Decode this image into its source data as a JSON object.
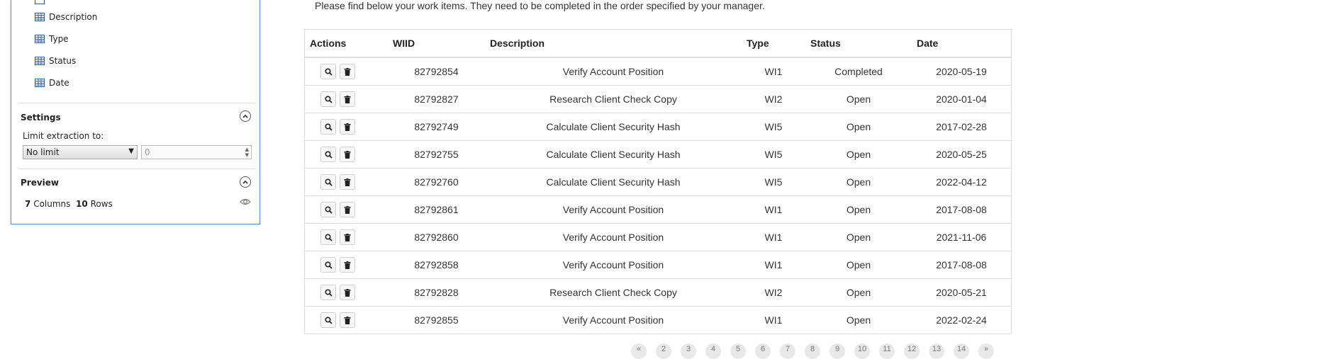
{
  "panel": {
    "columns": [
      {
        "label": "Description",
        "icon": "table-column-icon"
      },
      {
        "label": "Type",
        "icon": "table-column-icon"
      },
      {
        "label": "Status",
        "icon": "table-column-icon"
      },
      {
        "label": "Date",
        "icon": "table-column-icon"
      }
    ],
    "settings": {
      "title": "Settings",
      "limit_label": "Limit extraction to:",
      "limit_select": "No limit",
      "limit_value_placeholder": "0"
    },
    "preview": {
      "title": "Preview",
      "columns_count": "7",
      "columns_word": "Columns",
      "rows_count": "10",
      "rows_word": "Rows"
    }
  },
  "intro": "Please find below your work items. They need to be completed in the order specified by your manager.",
  "table": {
    "headers": [
      "Actions",
      "WIID",
      "Description",
      "Type",
      "Status",
      "Date"
    ],
    "rows": [
      {
        "wiid": "82792854",
        "description": "Verify Account Position",
        "type": "WI1",
        "status": "Completed",
        "date": "2020-05-19"
      },
      {
        "wiid": "82792827",
        "description": "Research Client Check Copy",
        "type": "WI2",
        "status": "Open",
        "date": "2020-01-04"
      },
      {
        "wiid": "82792749",
        "description": "Calculate Client Security Hash",
        "type": "WI5",
        "status": "Open",
        "date": "2017-02-28"
      },
      {
        "wiid": "82792755",
        "description": "Calculate Client Security Hash",
        "type": "WI5",
        "status": "Open",
        "date": "2020-05-25"
      },
      {
        "wiid": "82792760",
        "description": "Calculate Client Security Hash",
        "type": "WI5",
        "status": "Open",
        "date": "2022-04-12"
      },
      {
        "wiid": "82792861",
        "description": "Verify Account Position",
        "type": "WI1",
        "status": "Open",
        "date": "2017-08-08"
      },
      {
        "wiid": "82792860",
        "description": "Verify Account Position",
        "type": "WI1",
        "status": "Open",
        "date": "2021-11-06"
      },
      {
        "wiid": "82792858",
        "description": "Verify Account Position",
        "type": "WI1",
        "status": "Open",
        "date": "2017-08-08"
      },
      {
        "wiid": "82792828",
        "description": "Research Client Check Copy",
        "type": "WI2",
        "status": "Open",
        "date": "2020-05-21"
      },
      {
        "wiid": "82792855",
        "description": "Verify Account Position",
        "type": "WI1",
        "status": "Open",
        "date": "2022-02-24"
      }
    ]
  },
  "pagination": [
    "«",
    "2",
    "3",
    "4",
    "5",
    "6",
    "7",
    "8",
    "9",
    "10",
    "11",
    "12",
    "13",
    "14",
    "»"
  ]
}
